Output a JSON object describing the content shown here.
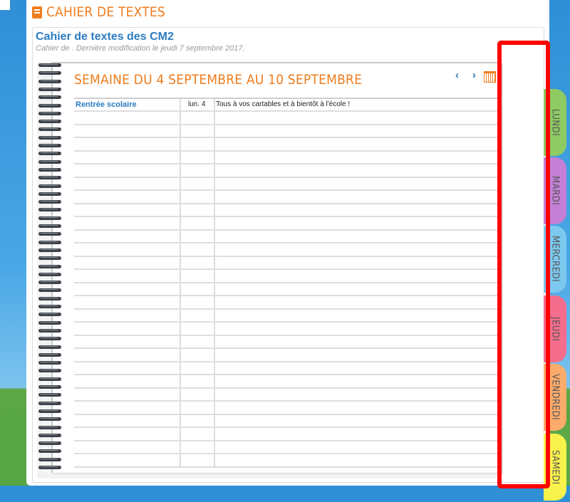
{
  "app": {
    "title": "CAHIER DE TEXTES"
  },
  "class": {
    "title": "Cahier de textes des CM2",
    "subtitle": "Cahier de . Dernière modification le jeudi 7 septembre 2017."
  },
  "week": {
    "title": "SEMAINE DU 4 SEPTEMBRE AU 10 SEPTEMBRE",
    "prev_label": "‹",
    "next_label": "›"
  },
  "entries": [
    {
      "subject": "Rentrée scolaire",
      "date": "lun. 4",
      "text": "Tous à vos cartables et à bientôt à l'école !"
    }
  ],
  "tabs": [
    {
      "label": "LUNDI",
      "color": "#8ecb63"
    },
    {
      "label": "MARDI",
      "color": "#c480d6"
    },
    {
      "label": "MERCREDI",
      "color": "#7cc8ee"
    },
    {
      "label": "JEUDI",
      "color": "#f46d8d"
    },
    {
      "label": "VENDREDI",
      "color": "#fbab6b"
    },
    {
      "label": "SAMEDI",
      "color": "#f8f24c"
    }
  ],
  "colors": {
    "accent": "#f07d1e",
    "link": "#2c7cc0",
    "highlight": "#ff0000"
  }
}
